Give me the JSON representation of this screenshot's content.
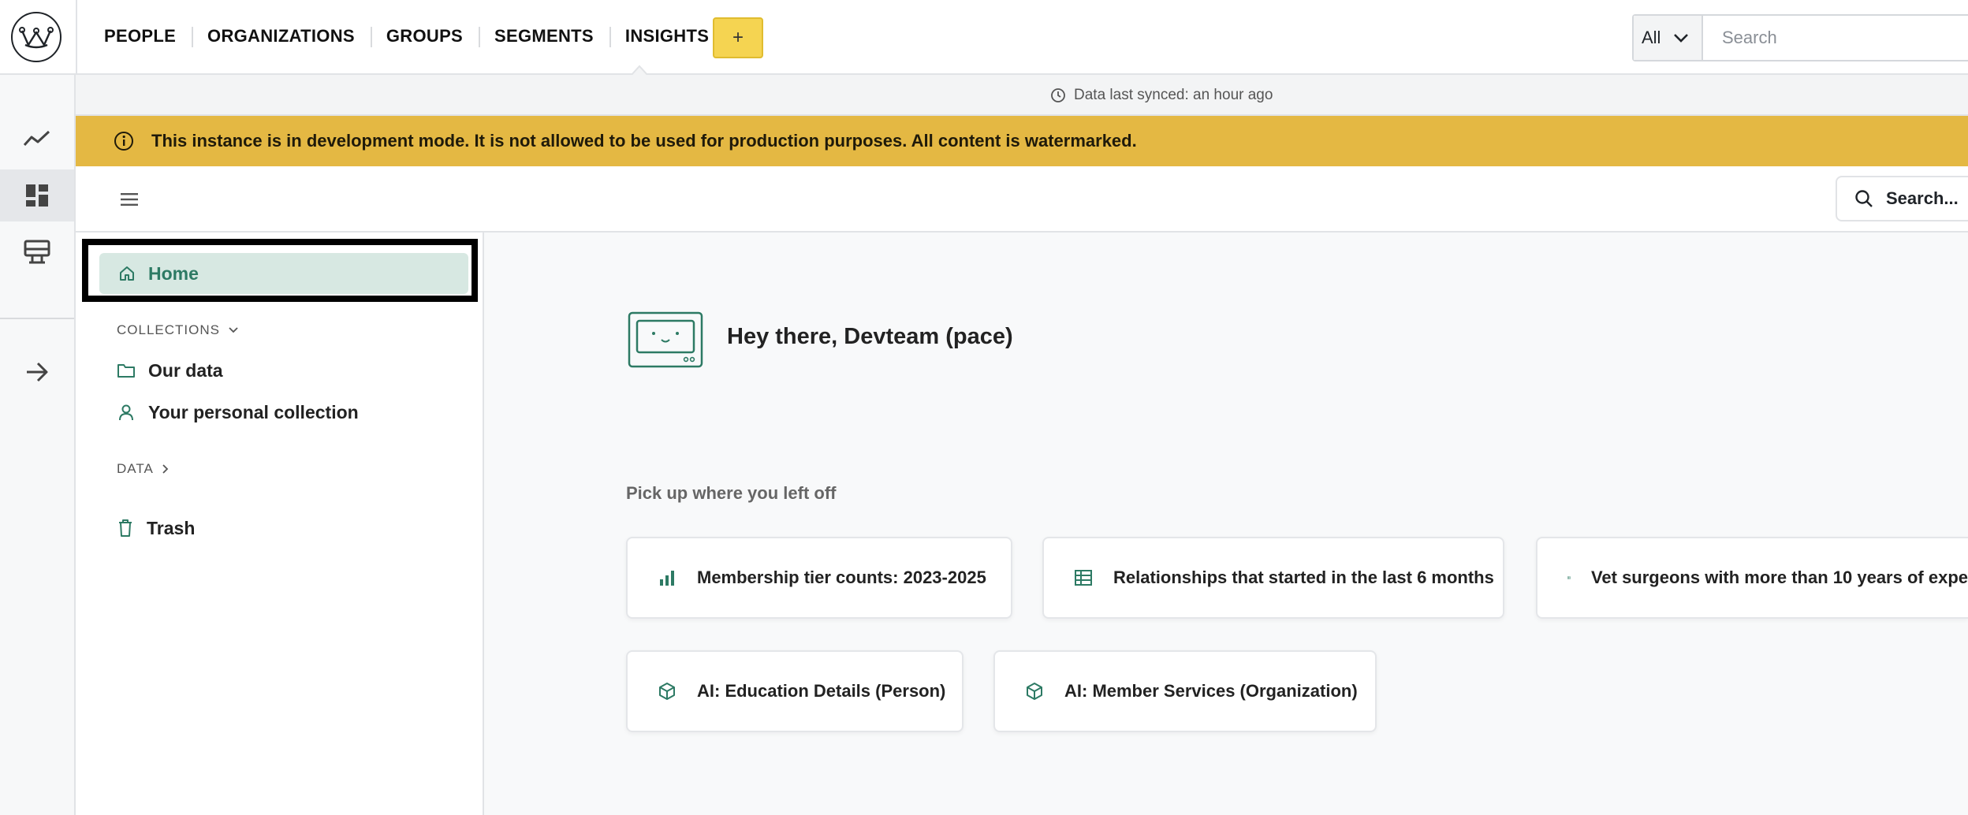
{
  "topnav": {
    "items": [
      "PEOPLE",
      "ORGANIZATIONS",
      "GROUPS",
      "SEGMENTS",
      "INSIGHTS"
    ],
    "active": "INSIGHTS",
    "add_label": "+",
    "search_scope": "All",
    "search_placeholder": "Search"
  },
  "sync": {
    "text": "Data last synced: an hour ago"
  },
  "banner": {
    "text": "This instance is in development mode. It is not allowed to be used for production purposes. All content is watermarked.",
    "color": "#e4b843"
  },
  "app_search": {
    "label": "Search..."
  },
  "sidebar": {
    "home_label": "Home",
    "collections_label": "COLLECTIONS",
    "collections": [
      {
        "label": "Our data",
        "icon": "folder-icon"
      },
      {
        "label": "Your personal collection",
        "icon": "person-icon"
      }
    ],
    "data_label": "DATA",
    "trash_label": "Trash"
  },
  "main": {
    "greeting": "Hey there, Devteam (pace)",
    "pickup_label": "Pick up where you left off",
    "recent": [
      {
        "label": "Membership tier counts: 2023-2025",
        "icon": "bar-chart-icon"
      },
      {
        "label": "Relationships that started in the last 6 months",
        "icon": "table-icon"
      },
      {
        "label": "Vet surgeons with more than 10 years of expe",
        "icon": "table-icon"
      },
      {
        "label": "AI: Education Details (Person)",
        "icon": "model-cube-icon"
      },
      {
        "label": "AI: Member Services (Organization)",
        "icon": "model-cube-icon"
      }
    ]
  },
  "colors": {
    "accent": "#2d7a64",
    "home_bg": "#d7e8e2",
    "add_button": "#f5d451"
  }
}
